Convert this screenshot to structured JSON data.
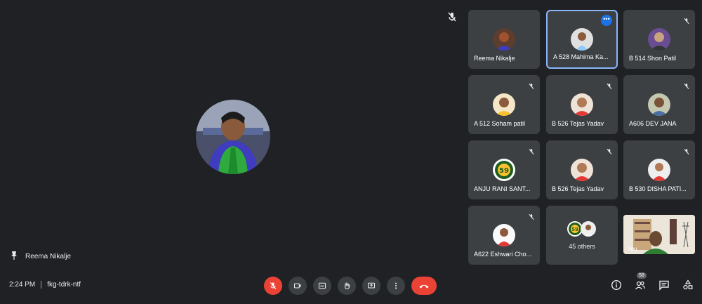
{
  "main": {
    "speaker_label": "Reema Nikalje"
  },
  "tiles": [
    {
      "name": "Reema Nikalje",
      "color": "#6d4c41"
    },
    {
      "name": "A 528 Mahima Ka...",
      "color": "#d7ccc8",
      "active": true
    },
    {
      "name": "B 514 Shon Patil",
      "color": "#7e57c2"
    },
    {
      "name": "A 512 Soham patil",
      "color": "#8d6e63"
    },
    {
      "name": "B 526 Tejas Yadav",
      "color": "#bcaaa4"
    },
    {
      "name": "A606 DEV JANA",
      "color": "#a1887f"
    },
    {
      "name": "ANJU RANI SANT...",
      "color": "#fbc02d"
    },
    {
      "name": "B 526 Tejas Yadav",
      "color": "#bcaaa4"
    },
    {
      "name": "B 530 DISHA PATI...",
      "color": "#e57373"
    },
    {
      "name": "A622 Eshwari Cho...",
      "color": "#f8bbd0"
    }
  ],
  "others": {
    "label": "45 others"
  },
  "self_view": {
    "label": "You"
  },
  "bottom_bar": {
    "time": "2:24 PM",
    "meeting_code": "fkg-tdrk-ntf",
    "participant_count": "58"
  },
  "colors": {
    "background": "#202124",
    "tile": "#3c4043",
    "red": "#ea4335",
    "accent": "#1a73e8"
  }
}
